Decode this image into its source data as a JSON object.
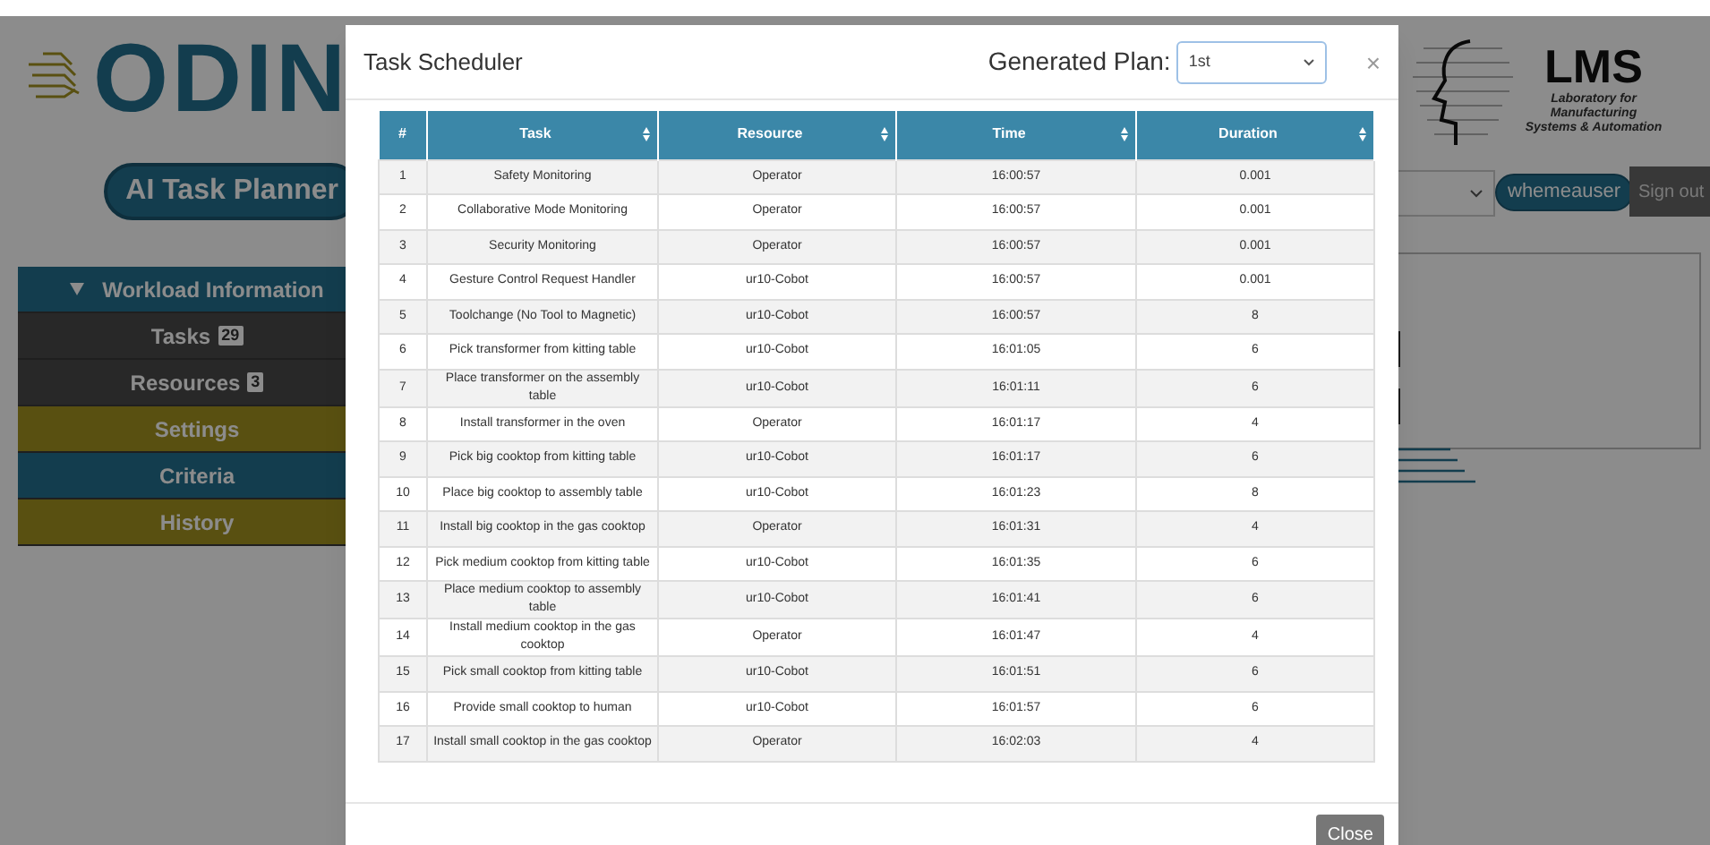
{
  "app": {
    "logo": "ODIN",
    "subtitle": "AI Task Planner",
    "sidebar": {
      "items": [
        {
          "label": "Workload Information",
          "kind": "group",
          "expanded": true
        },
        {
          "label": "Tasks",
          "badge": "29",
          "kind": "dark"
        },
        {
          "label": "Resources",
          "badge": "3",
          "kind": "dark"
        },
        {
          "label": "Settings",
          "kind": "olive"
        },
        {
          "label": "Criteria",
          "kind": "teal"
        },
        {
          "label": "History",
          "kind": "olive"
        }
      ]
    },
    "partner_logo": {
      "title": "LMS",
      "subtitle": "Laboratory for Manufacturing Systems & Automation"
    },
    "user": "whemeauser",
    "sign_out": "Sign out"
  },
  "modal": {
    "title": "Task Scheduler",
    "plan_label": "Generated Plan:",
    "plan_value": "1st",
    "close_icon": "×",
    "columns": [
      {
        "label": "#",
        "sortable": false
      },
      {
        "label": "Task",
        "sortable": true
      },
      {
        "label": "Resource",
        "sortable": true
      },
      {
        "label": "Time",
        "sortable": true
      },
      {
        "label": "Duration",
        "sortable": true
      }
    ],
    "rows": [
      [
        "1",
        "Safety Monitoring",
        "Operator",
        "16:00:57",
        "0.001"
      ],
      [
        "2",
        "Collaborative Mode Monitoring",
        "Operator",
        "16:00:57",
        "0.001"
      ],
      [
        "3",
        "Security Monitoring",
        "Operator",
        "16:00:57",
        "0.001"
      ],
      [
        "4",
        "Gesture Control Request Handler",
        "ur10-Cobot",
        "16:00:57",
        "0.001"
      ],
      [
        "5",
        "Toolchange (No Tool to Magnetic)",
        "ur10-Cobot",
        "16:00:57",
        "8"
      ],
      [
        "6",
        "Pick transformer from kitting table",
        "ur10-Cobot",
        "16:01:05",
        "6"
      ],
      [
        "7",
        "Place transformer on the assembly table",
        "ur10-Cobot",
        "16:01:11",
        "6"
      ],
      [
        "8",
        "Install transformer in the oven",
        "Operator",
        "16:01:17",
        "4"
      ],
      [
        "9",
        "Pick big cooktop from kitting table",
        "ur10-Cobot",
        "16:01:17",
        "6"
      ],
      [
        "10",
        "Place big cooktop to assembly table",
        "ur10-Cobot",
        "16:01:23",
        "8"
      ],
      [
        "11",
        "Install big cooktop in the gas cooktop",
        "Operator",
        "16:01:31",
        "4"
      ],
      [
        "12",
        "Pick medium cooktop from kitting table",
        "ur10-Cobot",
        "16:01:35",
        "6"
      ],
      [
        "13",
        "Place medium cooktop to assembly table",
        "ur10-Cobot",
        "16:01:41",
        "6"
      ],
      [
        "14",
        "Install medium cooktop in the gas cooktop",
        "Operator",
        "16:01:47",
        "4"
      ],
      [
        "15",
        "Pick small cooktop from kitting table",
        "ur10-Cobot",
        "16:01:51",
        "6"
      ],
      [
        "16",
        "Provide small cooktop to human",
        "ur10-Cobot",
        "16:01:57",
        "6"
      ],
      [
        "17",
        "Install small cooktop in the gas cooktop",
        "Operator",
        "16:02:03",
        "4"
      ]
    ],
    "close_button": "Close"
  }
}
